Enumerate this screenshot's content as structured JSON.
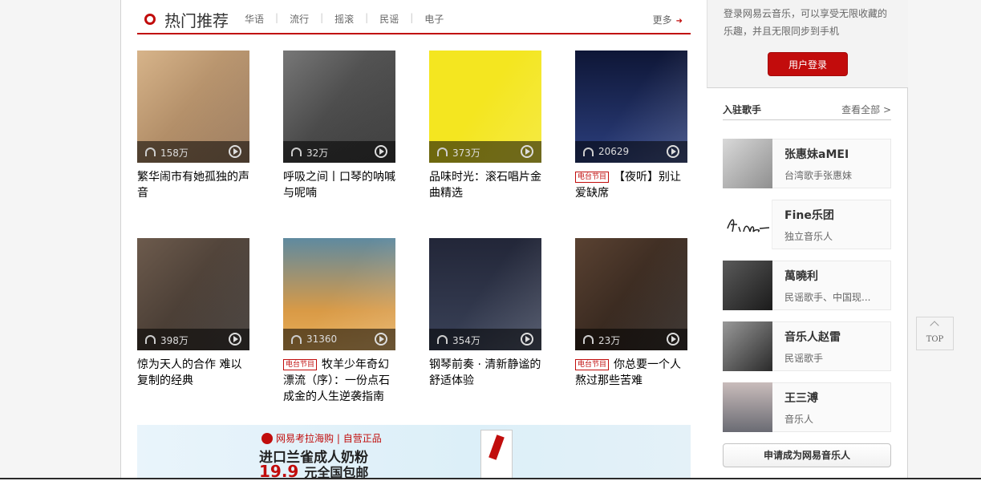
{
  "hot": {
    "title": "热门推荐",
    "tabs": [
      "华语",
      "流行",
      "摇滚",
      "民谣",
      "电子"
    ],
    "more": "更多"
  },
  "playlists": [
    {
      "count": "158万",
      "title": "繁华闹市有她孤独的声音",
      "radio": false,
      "cover": "#c49a70"
    },
    {
      "count": "32万",
      "title": "呼吸之间丨口琴的呐喊与呢喃",
      "radio": false,
      "cover": "#3a3a3a"
    },
    {
      "count": "373万",
      "title": "品味时光：滚石唱片金曲精选",
      "radio": false,
      "cover": "#f4e620"
    },
    {
      "count": "20629",
      "title": "【夜听】别让爱缺席",
      "radio": true,
      "cover": "#1d2b5a"
    },
    {
      "count": "398万",
      "title": "惊为天人的合作 难以复制的经典",
      "radio": false,
      "cover": "#4a3f39"
    },
    {
      "count": "31360",
      "title": "牧羊少年奇幻漂流（序）：一份点石成金的人生逆袭指南",
      "radio": true,
      "cover": "#d08a3c"
    },
    {
      "count": "354万",
      "title": "钢琴前奏 · 清新静谧的舒适体验",
      "radio": false,
      "cover": "#262a3c"
    },
    {
      "count": "23万",
      "title": "你总要一个人熬过那些苦难",
      "radio": true,
      "cover": "#3b2a20"
    }
  ],
  "radio_badge": "电台节目",
  "ad": {
    "brand": "网易考拉海购",
    "tag": "自营正品",
    "line1": "进口兰雀成人奶粉",
    "price": "19.9",
    "price_suffix": "元全国包邮"
  },
  "login": {
    "text": "登录网易云音乐，可以享受无限收藏的乐趣，并且无限同步到手机",
    "button": "用户登录"
  },
  "artists": {
    "title": "入驻歌手",
    "view_all": "查看全部 >",
    "items": [
      {
        "name": "张惠妹aMEI",
        "desc": "台湾歌手张惠妹",
        "photo": "#b8b8b8"
      },
      {
        "name": "Fine乐团",
        "desc": "独立音乐人",
        "photo": "#ffffff"
      },
      {
        "name": "萬曉利",
        "desc": "民谣歌手、中国现...",
        "photo": "#2e2e2e"
      },
      {
        "name": "音乐人赵雷",
        "desc": "民谣歌手",
        "photo": "#555555"
      },
      {
        "name": "王三溥",
        "desc": "音乐人",
        "photo": "#a89c9a"
      }
    ],
    "apply": "申请成为网易音乐人"
  },
  "back_to_top": "TOP"
}
